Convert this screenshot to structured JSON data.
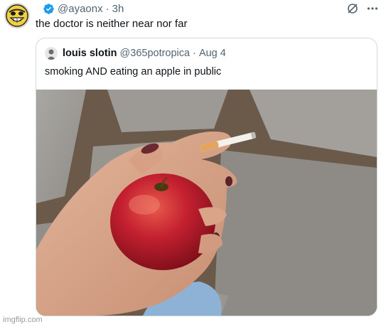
{
  "post": {
    "handle": "@ayaonx",
    "separator": "·",
    "time": "3h",
    "text": "the doctor is neither near nor far"
  },
  "quote": {
    "name": "louis slotin",
    "handle": "@365potropica",
    "separator": "·",
    "date": "Aug 4",
    "text": "smoking AND eating an apple in public"
  },
  "watermark": "imgflip.com",
  "icons": {
    "verified": "verified-badge-icon",
    "grok": "grok-icon",
    "more": "more-icon"
  },
  "colors": {
    "verified": "#1d9bf0",
    "secondary_text": "#536471",
    "primary_text": "#0f1419",
    "border": "#cfd9de",
    "apple": "#c0202a"
  }
}
